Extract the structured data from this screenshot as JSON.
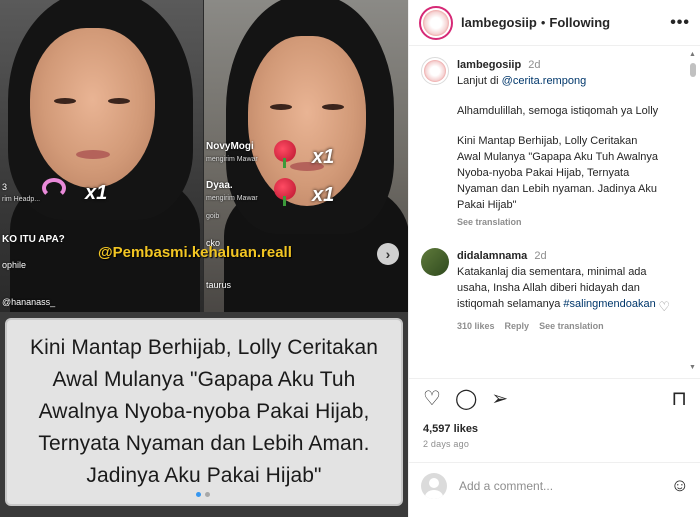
{
  "media": {
    "left_frame": {
      "number_label": "3",
      "gift_sender_sub": "rim Headp...",
      "question": "KO ITU APA?",
      "user_a": "ophile",
      "user_b": "@hananass_",
      "multiplier": "x1"
    },
    "right_frame": {
      "user_1": "NovyMogi",
      "user_1_sub": "mengirim Mawar",
      "user_2": "Dyaa.",
      "user_2_sub": "mengirim Mawar",
      "user_3": "goib",
      "user_4": "cko",
      "user_5": "taurus",
      "multiplier_1": "x1",
      "multiplier_2": "x1"
    },
    "watermark": "@Pembasmi.kehaluan.reall",
    "caption": "Kini Mantap Berhijab, Lolly Ceritakan Awal Mulanya \"Gapapa Aku Tuh Awalnya Nyoba-nyoba Pakai Hijab, Ternyata Nyaman dan Lebih Aman. Jadinya Aku Pakai Hijab\"",
    "next_icon": "chevron-right-icon"
  },
  "header": {
    "username": "lambegosiip",
    "separator": "•",
    "follow_status": "Following",
    "more_icon": "•••"
  },
  "caption_post": {
    "username": "lambegosiip",
    "time": "2d",
    "line1_prefix": "Lanjut di ",
    "line1_mention": "@cerita.rempong",
    "para2": "Alhamdulillah, semoga istiqomah ya Lolly",
    "para3": "Kini Mantap Berhijab, Lolly Ceritakan Awal Mulanya \"Gapapa Aku Tuh Awalnya Nyoba-nyoba Pakai Hijab, Ternyata Nyaman dan Lebih nyaman. Jadinya Aku Pakai Hijab\"",
    "see_translation": "See translation"
  },
  "comment": {
    "username": "didalamnama",
    "time": "2d",
    "text": "Katakanlaj dia sementara, minimal ada usaha, Insha Allah diberi hidayah dan istiqomah selamanya ",
    "hashtag": "#salingmendoakan",
    "likes": "310 likes",
    "reply": "Reply",
    "see_translation": "See translation"
  },
  "actions": {
    "likes": "4,597 likes",
    "ago": "2 days ago"
  },
  "add_comment": {
    "placeholder": "Add a comment..."
  }
}
